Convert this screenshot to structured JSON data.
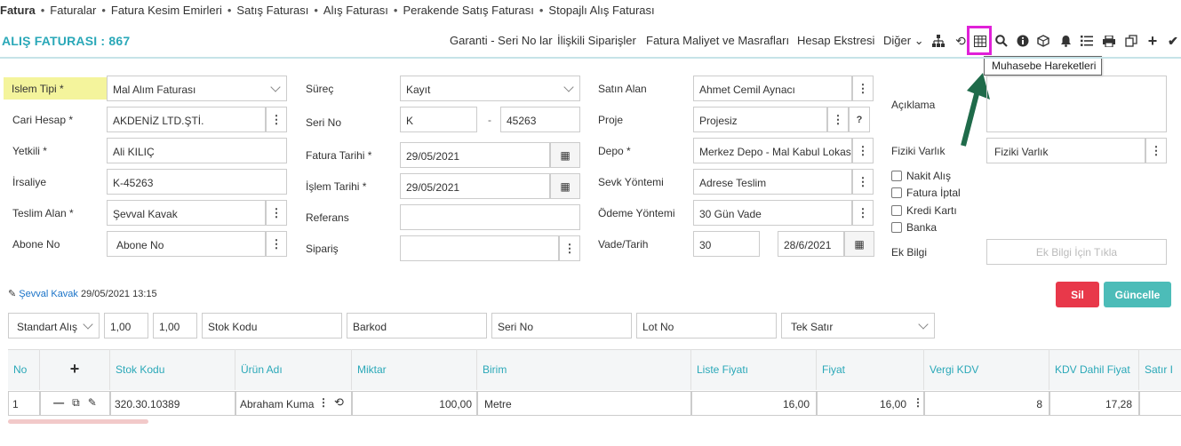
{
  "breadcrumbs": [
    "Fatura",
    "Faturalar",
    "Fatura Kesim Emirleri",
    "Satış Faturası",
    "Alış Faturası",
    "Perakende Satış Faturası",
    "Stopajlı Alış Faturası"
  ],
  "page_title": "ALIŞ FATURASI : 867",
  "top_links": [
    "Garanti - Seri No lar",
    "İlişkili Siparişler",
    "Fatura Maliyet ve Masrafları",
    "Hesap Ekstresi",
    "Diğer"
  ],
  "tooltip": "Muhasebe Hareketleri",
  "form": {
    "islem_tipi_label": "Islem Tipi *",
    "islem_tipi": "Mal Alım Faturası",
    "cari_label": "Cari Hesap *",
    "cari": "AKDENİZ LTD.ŞTİ.",
    "yetkili_label": "Yetkili *",
    "yetkili": "Ali KILIÇ",
    "irsaliye_label": "İrsaliye",
    "irsaliye": "K-45263",
    "teslim_label": "Teslim Alan *",
    "teslim": "Şevval Kavak",
    "abone_label": "Abone No",
    "abone_placeholder": "Abone No",
    "surec_label": "Süreç",
    "surec": "Kayıt",
    "seri_label": "Seri No",
    "seri": "K",
    "seri_dash": "-",
    "seri_no": "45263",
    "fatura_tarihi_label": "Fatura Tarihi *",
    "fatura_tarihi": "29/05/2021",
    "islem_tarihi_label": "İşlem Tarihi *",
    "islem_tarihi": "29/05/2021",
    "referans_label": "Referans",
    "siparis_label": "Sipariş",
    "satin_alan_label": "Satın Alan",
    "satin_alan": "Ahmet Cemil Aynacı",
    "proje_label": "Proje",
    "proje": "Projesiz",
    "proje_q": "?",
    "depo_label": "Depo *",
    "depo": "Merkez Depo - Mal Kabul Lokas",
    "sevk_label": "Sevk Yöntemi",
    "sevk": "Adrese Teslim",
    "odeme_label": "Ödeme Yöntemi",
    "odeme": "30 Gün Vade",
    "vade_label": "Vade/Tarih",
    "vade": "30",
    "vade_tarih": "28/6/2021",
    "aciklama_label": "Açıklama",
    "fiziki_label": "Fiziki Varlık",
    "fiziki": "Fiziki Varlık",
    "checkboxes": [
      "Nakit Alış",
      "Fatura İptal",
      "Kredi Kartı",
      "Banka"
    ],
    "ek_bilgi_label": "Ek Bilgi",
    "ek_bilgi_button": "Ek Bilgi İçin Tıkla"
  },
  "meta": {
    "user": "Şevval Kavak",
    "datetime": "29/05/2021 13:15"
  },
  "buttons": {
    "delete": "Sil",
    "update": "Güncelle"
  },
  "filter": {
    "type": "Standart Alış",
    "qty1": "1,00",
    "qty2": "1,00",
    "stok_kodu": "Stok Kodu",
    "barkod": "Barkod",
    "seri_no": "Seri No",
    "lot_no": "Lot No",
    "mode": "Tek Satır"
  },
  "table": {
    "headers": [
      "No",
      "+",
      "Stok Kodu",
      "Ürün Adı",
      "Miktar",
      "Birim",
      "Liste Fiyatı",
      "Fiyat",
      "Vergi KDV",
      "KDV Dahil Fiyat",
      "Satır I"
    ],
    "row": {
      "no": "1",
      "stok_kodu": "320.30.10389",
      "urun_adi": "Abraham Kuma",
      "miktar": "100,00",
      "birim": "Metre",
      "liste_fiyati": "16,00",
      "fiyat": "16,00",
      "vergi": "8",
      "kdv_dahil": "17,28"
    }
  },
  "colors": {
    "accent": "#2aa8b8",
    "danger": "#e8384a",
    "success": "#4cbcb8",
    "highlight": "#e020d8",
    "arrow": "#1f6b4a"
  }
}
